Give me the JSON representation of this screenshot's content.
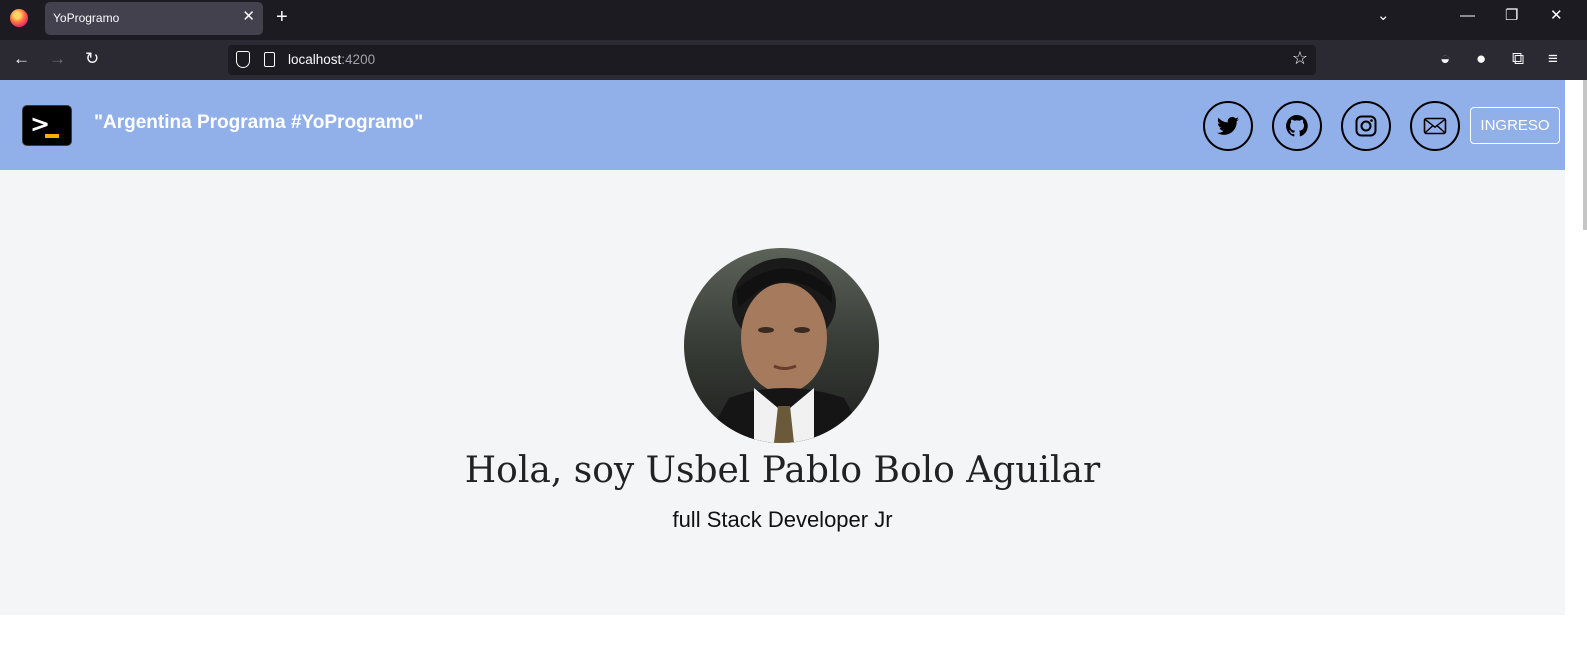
{
  "browser": {
    "tab_title": "YoProgramo",
    "url_host": "localhost",
    "url_port": ":4200"
  },
  "header": {
    "title": "\"Argentina Programa #YoProgramo\"",
    "login_label": "INGRESO",
    "social_icons": [
      "twitter-icon",
      "github-icon",
      "instagram-icon",
      "mail-icon"
    ]
  },
  "hero": {
    "name": "Hola, soy Usbel Pablo Bolo Aguilar",
    "role": "full Stack Developer Jr"
  },
  "colors": {
    "header_bg": "#91afe8",
    "hero_bg": "#f4f5f7",
    "chrome_dark": "#1c1b22"
  }
}
